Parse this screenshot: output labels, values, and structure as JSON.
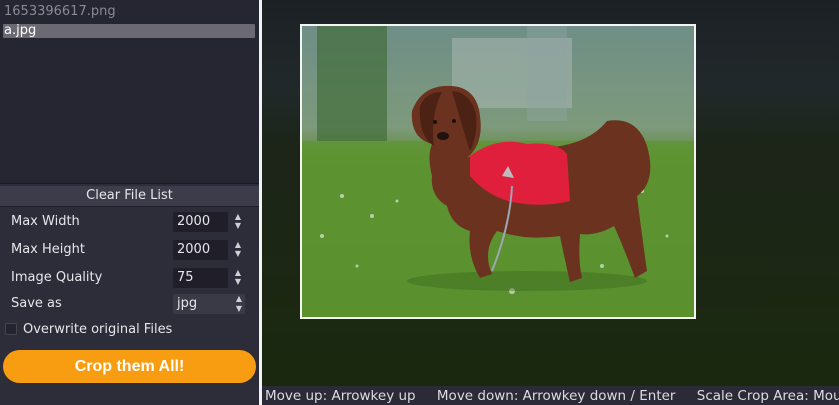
{
  "file_list": {
    "items": [
      {
        "name": "1653396617.png",
        "selected": false
      },
      {
        "name": "a.jpg",
        "selected": true
      }
    ]
  },
  "clear_button": "Clear File List",
  "settings": {
    "max_width": {
      "label": "Max Width",
      "value": "2000"
    },
    "max_height": {
      "label": "Max Height",
      "value": "2000"
    },
    "quality": {
      "label": "Image Quality",
      "value": "75"
    },
    "save_as": {
      "label": "Save as",
      "value": "jpg"
    },
    "overwrite": {
      "label": "Overwrite original Files",
      "checked": false
    }
  },
  "crop_button": "Crop them All!",
  "status": {
    "move_up": "Move up: Arrowkey up",
    "move_down": "Move down: Arrowkey down / Enter",
    "scale": "Scale Crop Area: Mouse Wheel"
  },
  "icons": {
    "spinner": "up-down-spinner-icon",
    "select": "select-arrows-icon",
    "checkbox": "checkbox-icon"
  },
  "colors": {
    "accent": "#f89d12",
    "sidebar": "#2d2c39",
    "selected_item": "#6b6a72"
  }
}
